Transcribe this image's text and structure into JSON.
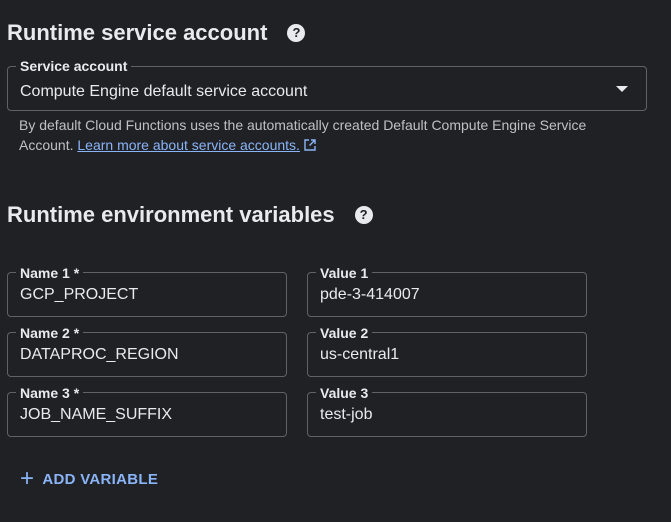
{
  "service_account_section": {
    "title": "Runtime service account",
    "field_label": "Service account",
    "selected_value": "Compute Engine default service account",
    "helper_text": "By default Cloud Functions uses the automatically created Default Compute Engine Service Account.",
    "learn_more_link": "Learn more about service accounts."
  },
  "env_vars_section": {
    "title": "Runtime environment variables",
    "variables": [
      {
        "name_label": "Name 1 *",
        "name": "GCP_PROJECT",
        "value_label": "Value 1",
        "value": "pde-3-414007"
      },
      {
        "name_label": "Name 2 *",
        "name": "DATAPROC_REGION",
        "value_label": "Value 2",
        "value": "us-central1"
      },
      {
        "name_label": "Name 3 *",
        "name": "JOB_NAME_SUFFIX",
        "value_label": "Value 3",
        "value": "test-job"
      }
    ],
    "add_button_label": "ADD VARIABLE"
  },
  "colors": {
    "background": "#202124",
    "text": "#e8eaed",
    "link": "#8ab4f8",
    "border": "#5f6368"
  },
  "icons": {
    "help": "help-circle-icon",
    "dropdown": "arrow-drop-down-icon",
    "external_link": "open-in-new-icon",
    "add": "plus-icon"
  }
}
